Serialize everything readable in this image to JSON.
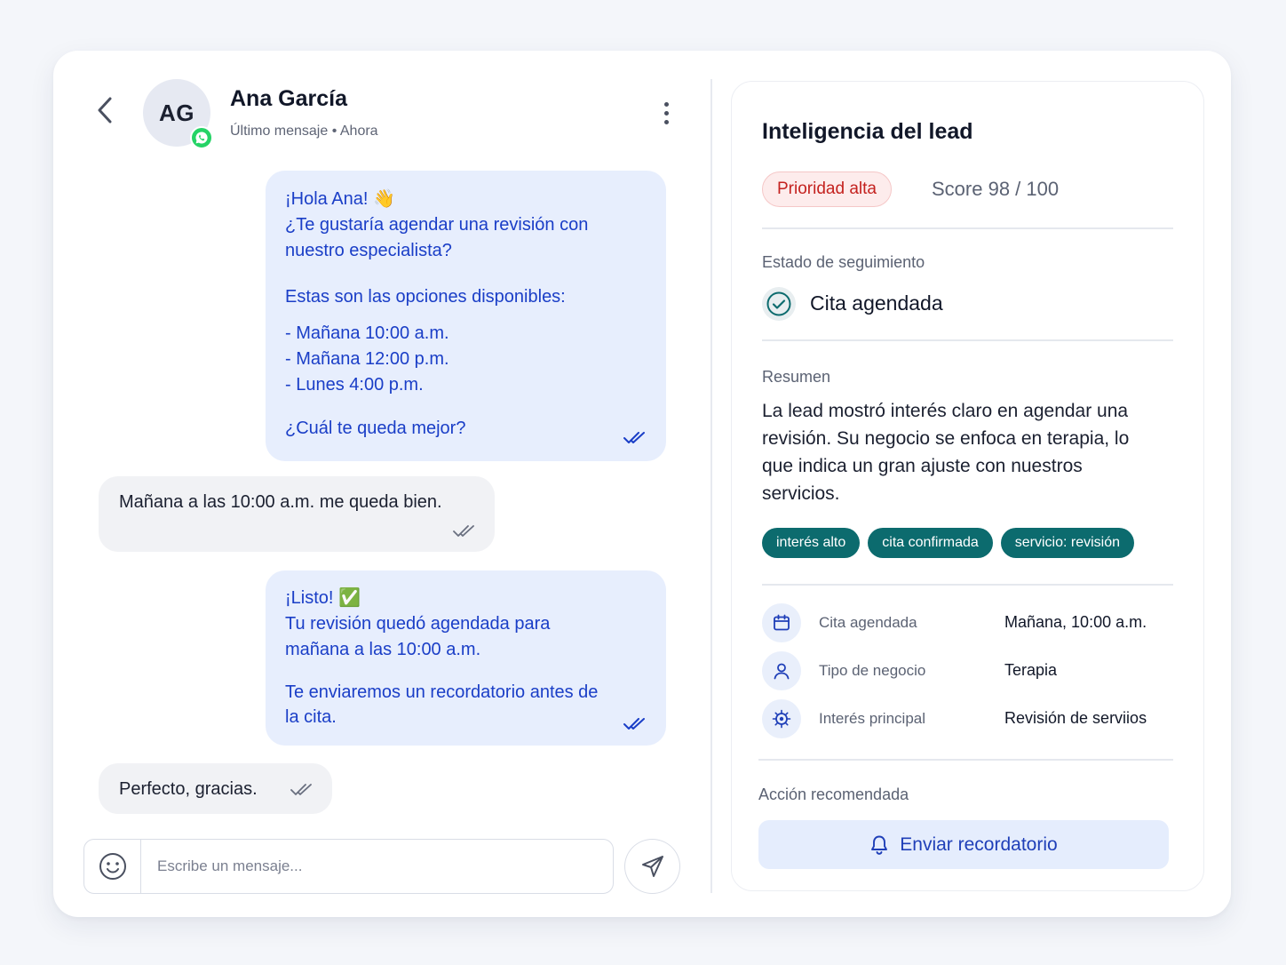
{
  "contact": {
    "initials": "AG",
    "name": "Ana García",
    "status": "Último mensaje • Ahora",
    "channel_icon": "whatsapp-icon"
  },
  "messages": [
    {
      "direction": "out",
      "lines": [
        "¡Hola Ana! 👋",
        "¿Te gustaría agendar una revisión con nuestro especialista?",
        "Estas son las opciones disponibles:",
        "- Mañana 10:00 a.m.",
        "- Mañana 12:00 p.m.",
        "- Lunes 4:00 p.m.",
        "¿Cuál te queda mejor?"
      ],
      "status": "read"
    },
    {
      "direction": "in",
      "text": "Mañana a las 10:00 a.m. me queda bien.",
      "status": "read"
    },
    {
      "direction": "out",
      "lines": [
        "¡Listo! ✅",
        "Tu revisión quedó agendada para mañana a las 10:00 a.m.",
        "Te enviaremos un recordatorio antes de la cita."
      ],
      "status": "read"
    },
    {
      "direction": "in",
      "text": "Perfecto, gracias.",
      "status": "read"
    }
  ],
  "composer": {
    "placeholder": "Escribe un mensaje..."
  },
  "lead": {
    "title": "Inteligencia del lead",
    "priority": "Prioridad alta",
    "score": "Score 98 / 100",
    "tracking_label": "Estado de seguimiento",
    "tracking_value": "Cita agendada",
    "summary_label": "Resumen",
    "summary": "La lead mostró interés claro en agendar una revisión. Su negocio se enfoca en terapia, lo que indica un gran ajuste con nuestros servicios.",
    "tags": [
      "interés alto",
      "cita confirmada",
      "servicio: revisión"
    ],
    "details": [
      {
        "icon": "calendar-icon",
        "label": "Cita agendada",
        "value": "Mañana, 10:00 a.m."
      },
      {
        "icon": "user-icon",
        "label": "Tipo de negocio",
        "value": "Terapia"
      },
      {
        "icon": "target-icon",
        "label": "Interés principal",
        "value": "Revisión de serviios"
      }
    ],
    "action_label": "Acción recomendada",
    "action_button": "Enviar recordatorio"
  },
  "colors": {
    "outgoing_bubble": "#e7eefd",
    "outgoing_text": "#1a3ec7",
    "incoming_bubble": "#f1f2f5",
    "tag_bg": "#0c6b6e",
    "priority_text": "#c4221f",
    "whatsapp": "#25d366"
  }
}
